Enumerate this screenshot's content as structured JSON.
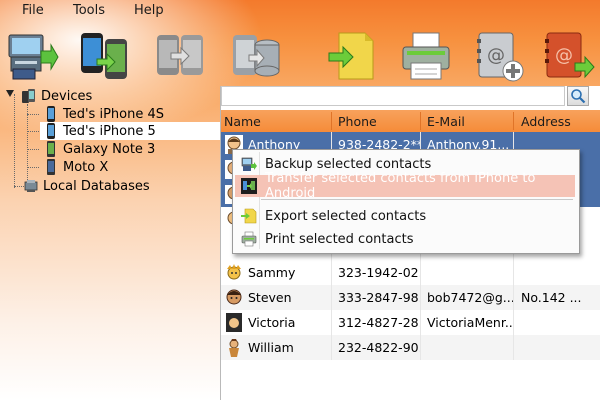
{
  "menubar": {
    "items": [
      {
        "label": "File"
      },
      {
        "label": "Tools"
      },
      {
        "label": "Help"
      }
    ]
  },
  "toolbar": {
    "buttons": [
      {
        "icon": "backup-to-computer-icon"
      },
      {
        "icon": "transfer-phone-to-phone-icon"
      },
      {
        "icon": "transfer-android-to-iphone-icon"
      },
      {
        "icon": "transfer-database-icon"
      },
      {
        "icon": "export-icon"
      },
      {
        "icon": "print-icon"
      },
      {
        "icon": "add-contact-icon"
      },
      {
        "icon": "export-contacts-book-icon"
      }
    ]
  },
  "tree": {
    "root": {
      "label": "Devices"
    },
    "devices": [
      {
        "label": "Ted's iPhone 4S"
      },
      {
        "label": "Ted's iPhone 5"
      },
      {
        "label": "Galaxy Note 3"
      },
      {
        "label": "Moto X"
      }
    ],
    "local": {
      "label": "Local Databases"
    }
  },
  "search": {
    "value": "",
    "placeholder": ""
  },
  "table": {
    "headers": [
      "Name",
      "Phone",
      "E-Mail",
      "Address"
    ],
    "rows": [
      {
        "name": "Anthony",
        "phone": "938-2482-2***",
        "email": "Anthony.91...",
        "address": ""
      },
      {
        "name": "",
        "phone": "",
        "email": "",
        "address": ""
      },
      {
        "name": "",
        "phone": "",
        "email": "",
        "address": ""
      },
      {
        "name": "",
        "phone": "",
        "email": "",
        "address": ""
      },
      {
        "name": "Sammy",
        "phone": "323-1942-02...",
        "email": "",
        "address": ""
      },
      {
        "name": "Steven",
        "phone": "333-2847-98...",
        "email": "bob7472@g...",
        "address": "No.142 ..."
      },
      {
        "name": "Victoria",
        "phone": "312-4827-28...",
        "email": "VictoriaMenr...",
        "address": ""
      },
      {
        "name": "William",
        "phone": "232-4822-90...",
        "email": "",
        "address": ""
      }
    ]
  },
  "context_menu": {
    "items": [
      {
        "label": "Backup selected contacts",
        "icon": "backup-icon"
      },
      {
        "label": "Transfer selected contacts from iPhone to Android",
        "icon": "transfer-icon"
      },
      {
        "label": "Export selected contacts",
        "icon": "export-icon"
      },
      {
        "label": "Print selected contacts",
        "icon": "print-icon"
      }
    ]
  },
  "colors": {
    "accent": "#f58b39",
    "selection": "#4a6fa8",
    "menu_hover": "#f5c3b6"
  }
}
